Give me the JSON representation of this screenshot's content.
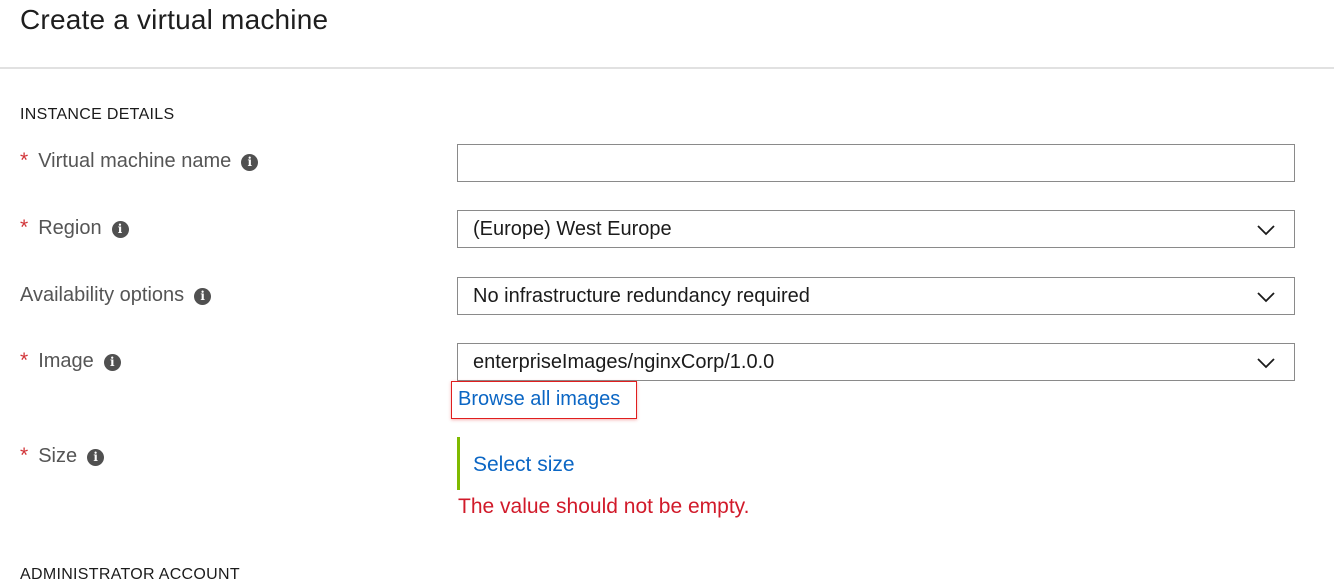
{
  "page": {
    "title": "Create a virtual machine"
  },
  "instance_details": {
    "heading": "INSTANCE DETAILS",
    "vm_name": {
      "required_marker": "*",
      "label": "Virtual machine name",
      "value": "",
      "info_icon": "info-icon"
    },
    "region": {
      "required_marker": "*",
      "label": "Region",
      "value": "(Europe) West Europe",
      "info_icon": "info-icon"
    },
    "availability": {
      "label": "Availability options",
      "value": "No infrastructure redundancy required",
      "info_icon": "info-icon"
    },
    "image": {
      "required_marker": "*",
      "label": "Image",
      "value": "enterpriseImages/nginxCorp/1.0.0",
      "info_icon": "info-icon",
      "browse_link": "Browse all images"
    },
    "size": {
      "required_marker": "*",
      "label": "Size",
      "info_icon": "info-icon",
      "select_link": "Select size",
      "error": "The value should not be empty."
    }
  },
  "administrator_account": {
    "heading": "ADMINISTRATOR ACCOUNT"
  },
  "colors": {
    "required": "#d13438",
    "link": "#0b66c4",
    "error": "#d11a2a",
    "highlight_border": "#e01e1e",
    "validation_bar": "#7fba00"
  }
}
